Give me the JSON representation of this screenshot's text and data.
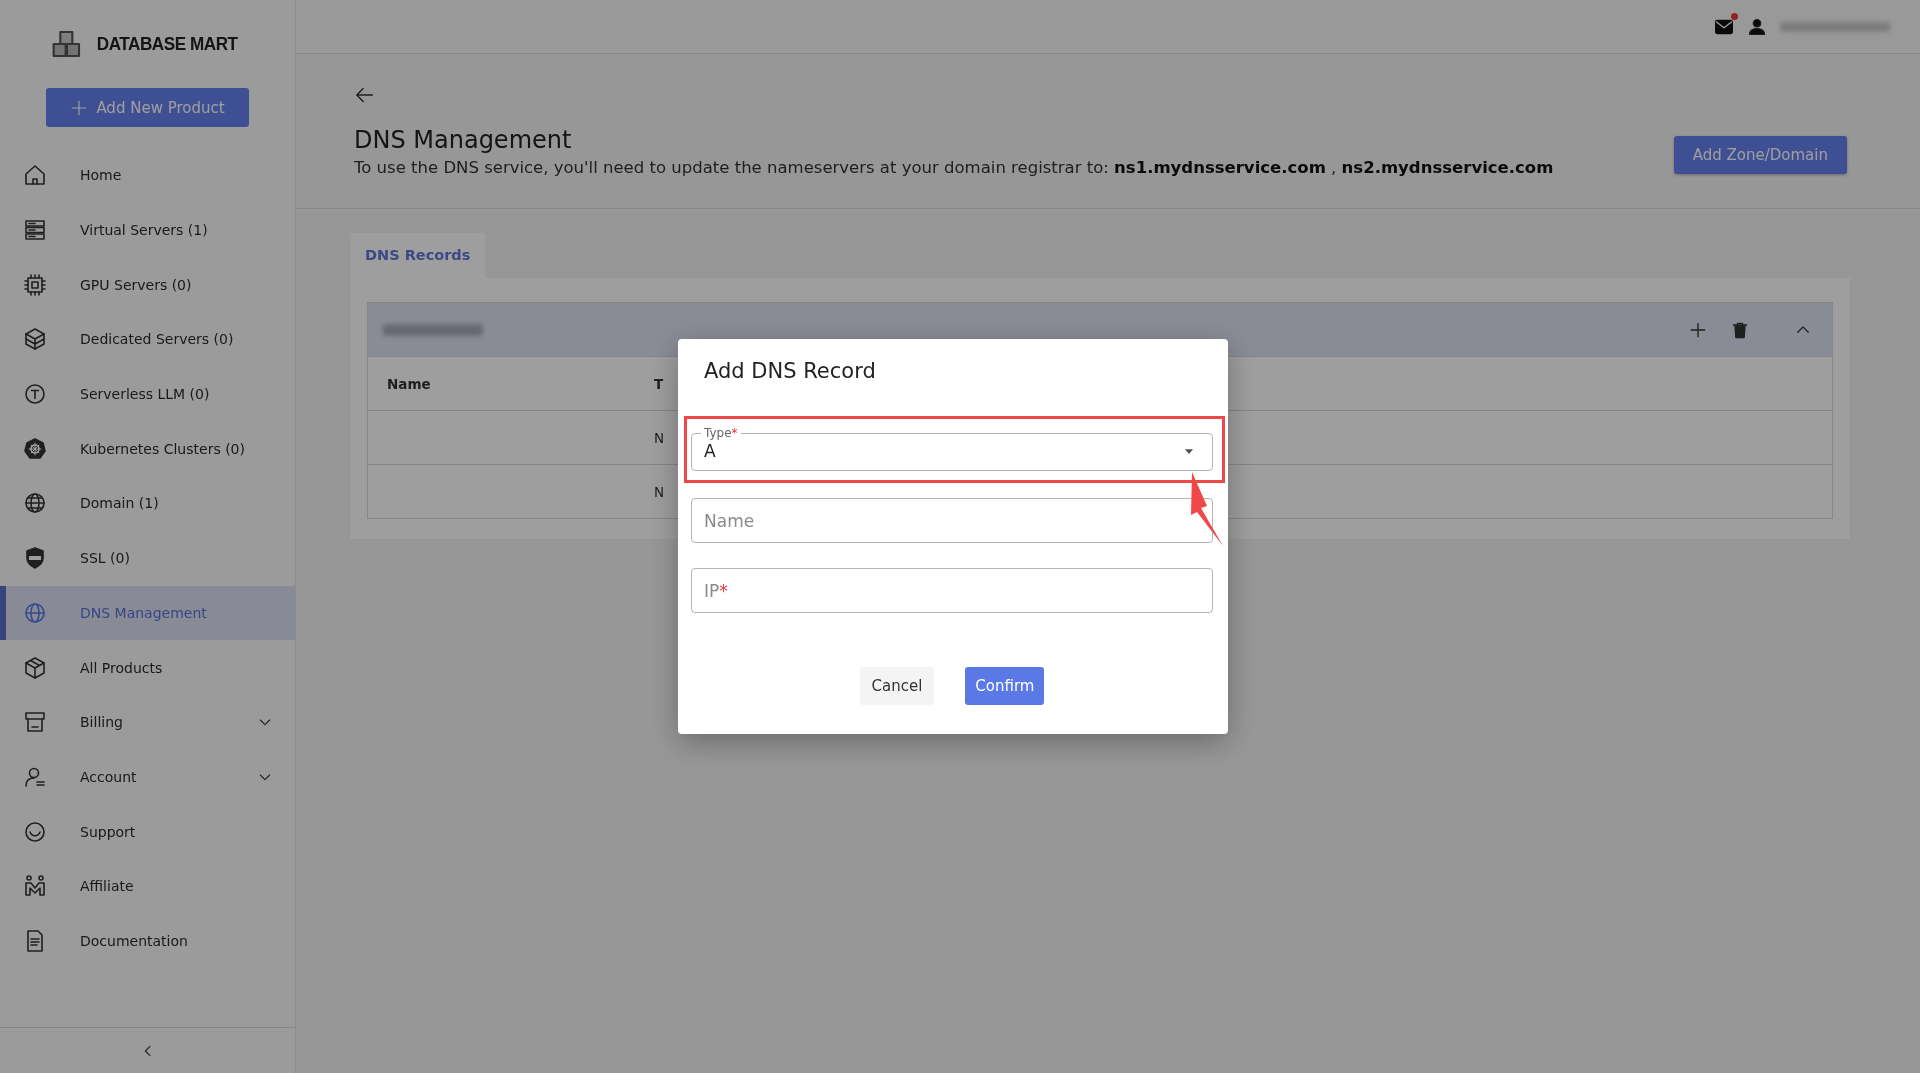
{
  "topbar": {
    "unread_notifications": true
  },
  "sidebar": {
    "logo": "DATABASE MART",
    "add_button": "Add New Product",
    "items": [
      {
        "label": "Home",
        "kind": "link",
        "selected": false
      },
      {
        "label": "Virtual Servers (1)",
        "kind": "link",
        "selected": false
      },
      {
        "label": "GPU Servers (0)",
        "kind": "link",
        "selected": false
      },
      {
        "label": "Dedicated Servers (0)",
        "kind": "link",
        "selected": false
      },
      {
        "label": "Serverless LLM (0)",
        "kind": "link",
        "selected": false
      },
      {
        "label": "Kubernetes Clusters (0)",
        "kind": "link",
        "selected": false
      },
      {
        "label": "Domain (1)",
        "kind": "link",
        "selected": false
      },
      {
        "label": "SSL (0)",
        "kind": "link",
        "selected": false
      },
      {
        "label": "DNS Management",
        "kind": "link",
        "selected": true
      },
      {
        "label": "All Products",
        "kind": "link",
        "selected": false
      },
      {
        "label": "Billing",
        "kind": "group",
        "selected": false,
        "expanded": false
      },
      {
        "label": "Account",
        "kind": "group",
        "selected": false,
        "expanded": false
      },
      {
        "label": "Support",
        "kind": "link",
        "selected": false
      },
      {
        "label": "Affiliate",
        "kind": "link",
        "selected": false
      },
      {
        "label": "Documentation",
        "kind": "link",
        "selected": false
      }
    ]
  },
  "page": {
    "title": "DNS Management",
    "description": "To use the DNS service, you'll need to update the nameservers at your domain registrar to: **ns1.mydnsservice.com** , **ns2.mydnsservice.com**",
    "action_button": "Add Zone/Domain"
  },
  "tabs": [
    {
      "label": "DNS Records",
      "selected": true
    }
  ],
  "records_table": {
    "columns": [
      {
        "label": "Name"
      },
      {
        "label": "T"
      }
    ],
    "rows": [
      {
        "column_2": "N"
      },
      {
        "column_2": "N"
      }
    ]
  },
  "dialog": {
    "title": "Add DNS Record",
    "fields": [
      {
        "kind": "select",
        "label": "Type",
        "required_mark": "*",
        "value": "A",
        "highlighted": true
      },
      {
        "kind": "text",
        "placeholder": "Name"
      },
      {
        "kind": "text",
        "placeholder": "IP",
        "required_mark": "*"
      }
    ],
    "buttons": [
      {
        "label": "Cancel",
        "kind": "secondary"
      },
      {
        "label": "Confirm",
        "kind": "primary"
      }
    ]
  }
}
